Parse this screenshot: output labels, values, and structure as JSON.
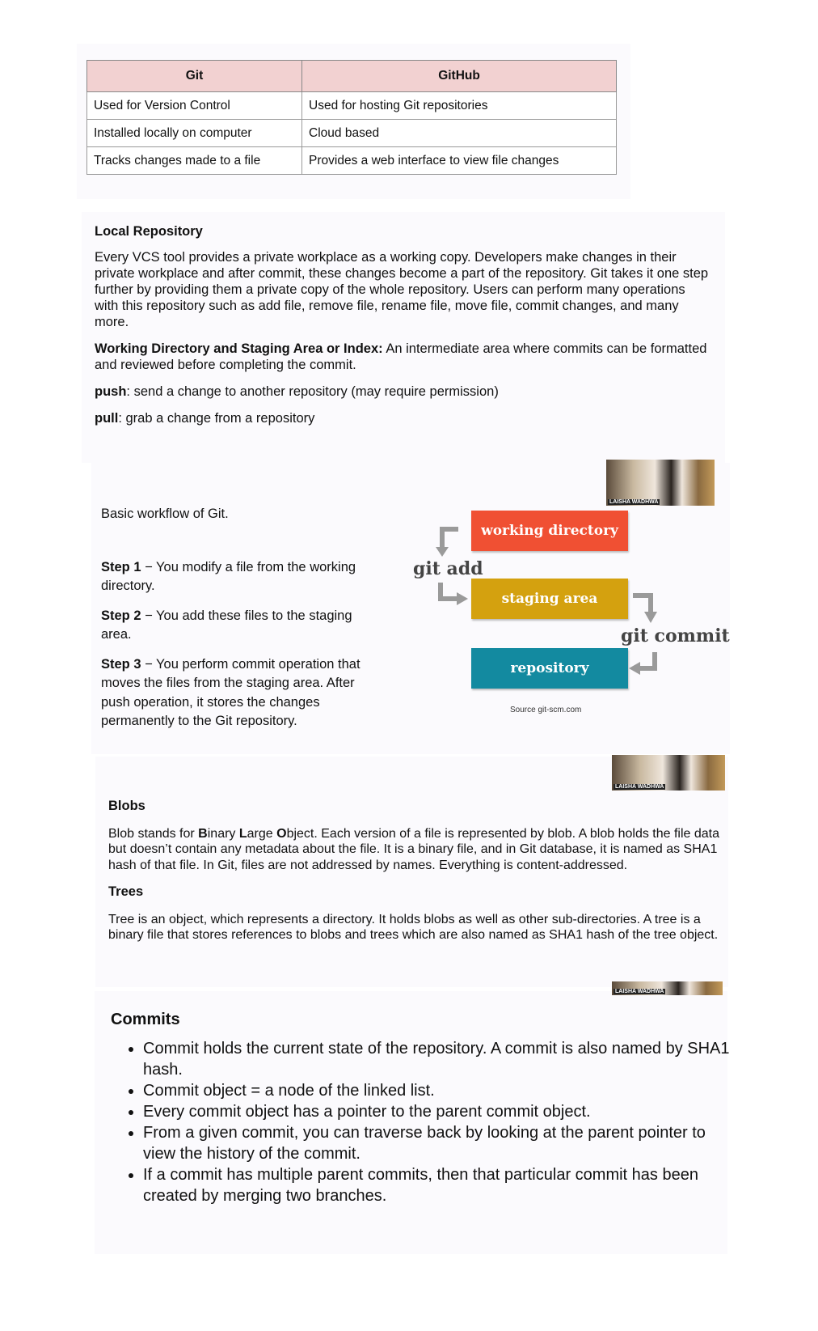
{
  "table": {
    "headers": [
      "Git",
      "GitHub"
    ],
    "rows": [
      [
        "Used for Version Control",
        "Used for hosting Git repositories"
      ],
      [
        "Installed locally on computer",
        "Cloud based"
      ],
      [
        "Tracks changes made to a file",
        "Provides a web interface to view file changes"
      ]
    ]
  },
  "local_repo": {
    "title": "Local Repository",
    "paragraph": "Every VCS tool provides a private workplace as a working copy. Developers make changes in their private workplace and after commit, these changes become a part of the repository. Git takes it one step further by providing them a private copy of the whole repository. Users can perform many operations with this repository such as add file, remove file, rename file, move file, commit changes, and many more.",
    "wd_term": "Working Directory and Staging Area or Index:",
    "wd_text": " An intermediate area where commits can be formatted and reviewed before completing the commit.",
    "push_term": "push",
    "push_text": ": send a change to another repository (may require permission)",
    "pull_term": "pull",
    "pull_text": ": grab a change from a repository"
  },
  "workflow": {
    "intro": "Basic workflow of Git.",
    "steps": [
      {
        "label": "Step 1",
        "text": " − You modify a file from the working directory."
      },
      {
        "label": "Step 2",
        "text": " − You add these files to the staging area."
      },
      {
        "label": "Step 3",
        "text": " − You perform commit operation that moves the files from the staging area. After push operation, it stores the changes permanently to the Git repository."
      }
    ],
    "diagram": {
      "working_directory": "working directory",
      "staging_area": "staging area",
      "repository": "repository",
      "git_add": "git add",
      "git_commit": "git commit",
      "source": "Source git-scm.com",
      "colors": {
        "working": "#f05033",
        "staging": "#d4a10f",
        "repository": "#138aa0",
        "arrows": "#9a9a9a"
      }
    },
    "webcam_name": "LAISHA WADHWA"
  },
  "objects": {
    "webcam_name": "LAISHA WADHWA",
    "blobs_title": "Blobs",
    "blobs_pre": "Blob stands for ",
    "b": "B",
    "b_rest": "inary ",
    "l": "L",
    "l_rest": "arge ",
    "o": "O",
    "o_rest": "bject. Each version of a file is represented by blob. A blob holds the file data but doesn’t contain any metadata about the file. It is a binary file, and in Git database, it is named as SHA1 hash of that file. In Git, files are not addressed by names. Everything is content-addressed.",
    "trees_title": "Trees",
    "trees_text": "Tree is an object, which represents a directory. It holds blobs as well as other sub-directories. A tree is a binary file that stores references to blobs and trees which are also named as SHA1 hash of the tree object."
  },
  "commits": {
    "webcam_name": "LAISHA WADHWA",
    "title": "Commits",
    "items": [
      "Commit holds the current state of the repository. A commit is also named by SHA1 hash.",
      "Commit object = a node of the linked list.",
      "Every commit object has a pointer to the parent commit object.",
      "From a given commit, you can traverse back by looking at the parent pointer to view the history of the commit.",
      "If a commit has multiple parent commits, then that particular commit has been created by merging two branches."
    ]
  }
}
